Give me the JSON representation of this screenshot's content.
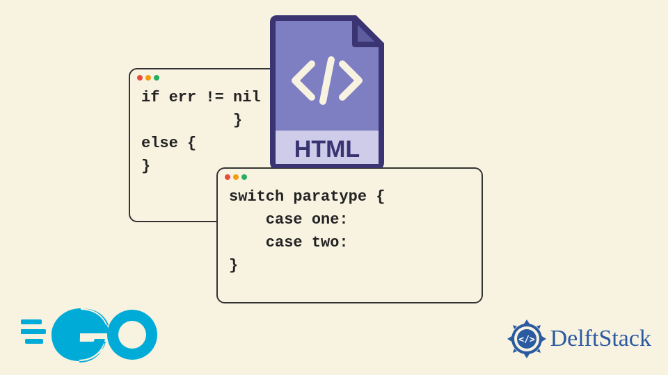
{
  "window1": {
    "code": "if err != nil {\n          }\nelse {\n}"
  },
  "window2": {
    "code": "switch paratype {\n    case one:\n    case two:\n}"
  },
  "html_icon": {
    "label": "HTML",
    "glyph": "</>"
  },
  "go_logo": {
    "text": "GO"
  },
  "delft": {
    "text": "DelftStack"
  },
  "colors": {
    "bg": "#f8f2e1",
    "purple": "#7e7ec2",
    "purple_dark": "#3a3473",
    "purple_light": "#cfcce9",
    "go_blue": "#00acd7",
    "delft_blue": "#2a5aa0"
  }
}
